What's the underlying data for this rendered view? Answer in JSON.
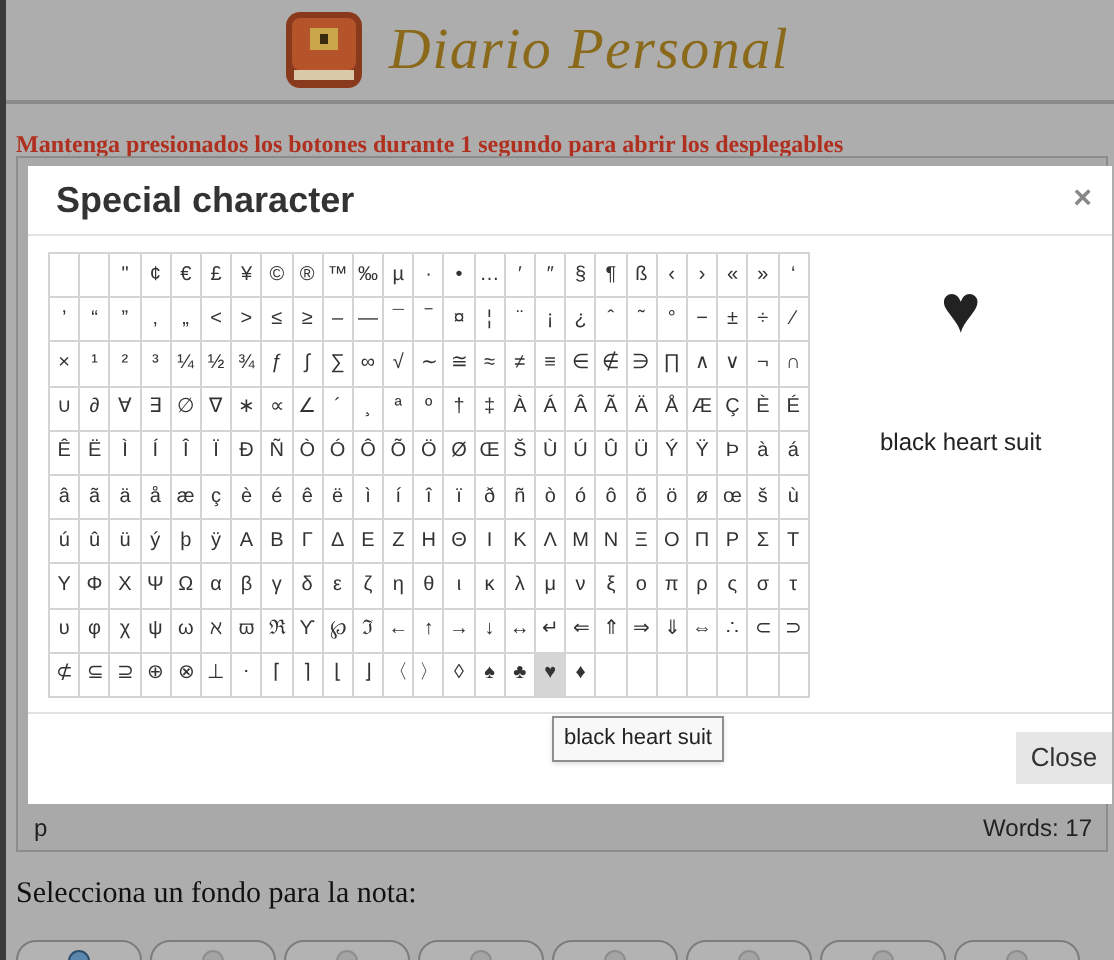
{
  "header": {
    "title": "Diario Personal"
  },
  "notice": "Mantenga presionados los botones durante 1 segundo para abrir los desplegables",
  "dialog": {
    "title": "Special character",
    "close_symbol": "×",
    "grid": [
      [
        {
          "selected": false
        },
        {
          "selected": false
        },
        {
          "c": "\"",
          "selected": false
        },
        {
          "c": "¢",
          "selected": false
        },
        {
          "c": "€",
          "selected": false
        },
        {
          "c": "£",
          "selected": false
        },
        {
          "c": "¥",
          "selected": false
        },
        {
          "c": "©",
          "selected": false
        },
        {
          "c": "®",
          "selected": false
        },
        {
          "c": "™",
          "selected": false
        },
        {
          "c": "‰",
          "selected": false
        },
        {
          "c": "µ",
          "selected": false
        },
        {
          "c": "·",
          "selected": false
        },
        {
          "c": "•",
          "selected": false
        },
        {
          "c": "…",
          "selected": false
        },
        {
          "c": "′",
          "selected": false
        },
        {
          "c": "″",
          "selected": false
        },
        {
          "c": "§",
          "selected": false
        },
        {
          "c": "¶",
          "selected": false
        },
        {
          "c": "ß",
          "selected": false
        },
        {
          "c": "‹",
          "selected": false
        },
        {
          "c": "›",
          "selected": false
        },
        {
          "c": "«",
          "selected": false
        },
        {
          "c": "»",
          "selected": false
        },
        {
          "c": "‘",
          "selected": false
        }
      ],
      [
        {
          "c": "’",
          "selected": false
        },
        {
          "c": "“",
          "selected": false
        },
        {
          "c": "”",
          "selected": false
        },
        {
          "c": "‚",
          "selected": false
        },
        {
          "c": "„",
          "selected": false
        },
        {
          "c": "<",
          "selected": false
        },
        {
          "c": ">",
          "selected": false
        },
        {
          "c": "≤",
          "selected": false
        },
        {
          "c": "≥",
          "selected": false
        },
        {
          "c": "–",
          "selected": false
        },
        {
          "c": "—",
          "selected": false
        },
        {
          "c": "¯",
          "selected": false
        },
        {
          "c": "‾",
          "selected": false
        },
        {
          "c": "¤",
          "selected": false
        },
        {
          "c": "¦",
          "selected": false
        },
        {
          "c": "¨",
          "selected": false
        },
        {
          "c": "¡",
          "selected": false
        },
        {
          "c": "¿",
          "selected": false
        },
        {
          "c": "ˆ",
          "selected": false
        },
        {
          "c": "˜",
          "selected": false
        },
        {
          "c": "°",
          "selected": false
        },
        {
          "c": "−",
          "selected": false
        },
        {
          "c": "±",
          "selected": false
        },
        {
          "c": "÷",
          "selected": false
        },
        {
          "c": "⁄",
          "selected": false
        }
      ],
      [
        {
          "c": "×",
          "selected": false
        },
        {
          "c": "¹",
          "selected": false
        },
        {
          "c": "²",
          "selected": false
        },
        {
          "c": "³",
          "selected": false
        },
        {
          "c": "¼",
          "selected": false
        },
        {
          "c": "½",
          "selected": false
        },
        {
          "c": "¾",
          "selected": false
        },
        {
          "c": "ƒ",
          "selected": false
        },
        {
          "c": "∫",
          "selected": false
        },
        {
          "c": "∑",
          "selected": false
        },
        {
          "c": "∞",
          "selected": false
        },
        {
          "c": "√",
          "selected": false
        },
        {
          "c": "∼",
          "selected": false
        },
        {
          "c": "≅",
          "selected": false
        },
        {
          "c": "≈",
          "selected": false
        },
        {
          "c": "≠",
          "selected": false
        },
        {
          "c": "≡",
          "selected": false
        },
        {
          "c": "∈",
          "selected": false
        },
        {
          "c": "∉",
          "selected": false
        },
        {
          "c": "∋",
          "selected": false
        },
        {
          "c": "∏",
          "selected": false
        },
        {
          "c": "∧",
          "selected": false
        },
        {
          "c": "∨",
          "selected": false
        },
        {
          "c": "¬",
          "selected": false
        },
        {
          "c": "∩",
          "selected": false
        }
      ],
      [
        {
          "c": "∪",
          "selected": false
        },
        {
          "c": "∂",
          "selected": false
        },
        {
          "c": "∀",
          "selected": false
        },
        {
          "c": "∃",
          "selected": false
        },
        {
          "c": "∅",
          "selected": false
        },
        {
          "c": "∇",
          "selected": false
        },
        {
          "c": "∗",
          "selected": false
        },
        {
          "c": "∝",
          "selected": false
        },
        {
          "c": "∠",
          "selected": false
        },
        {
          "c": "´",
          "selected": false
        },
        {
          "c": "¸",
          "selected": false
        },
        {
          "c": "ª",
          "selected": false
        },
        {
          "c": "º",
          "selected": false
        },
        {
          "c": "†",
          "selected": false
        },
        {
          "c": "‡",
          "selected": false
        },
        {
          "c": "À",
          "selected": false
        },
        {
          "c": "Á",
          "selected": false
        },
        {
          "c": "Â",
          "selected": false
        },
        {
          "c": "Ã",
          "selected": false
        },
        {
          "c": "Ä",
          "selected": false
        },
        {
          "c": "Å",
          "selected": false
        },
        {
          "c": "Æ",
          "selected": false
        },
        {
          "c": "Ç",
          "selected": false
        },
        {
          "c": "È",
          "selected": false
        },
        {
          "c": "É",
          "selected": false
        }
      ],
      [
        {
          "c": "Ê",
          "selected": false
        },
        {
          "c": "Ë",
          "selected": false
        },
        {
          "c": "Ì",
          "selected": false
        },
        {
          "c": "Í",
          "selected": false
        },
        {
          "c": "Î",
          "selected": false
        },
        {
          "c": "Ï",
          "selected": false
        },
        {
          "c": "Ð",
          "selected": false
        },
        {
          "c": "Ñ",
          "selected": false
        },
        {
          "c": "Ò",
          "selected": false
        },
        {
          "c": "Ó",
          "selected": false
        },
        {
          "c": "Ô",
          "selected": false
        },
        {
          "c": "Õ",
          "selected": false
        },
        {
          "c": "Ö",
          "selected": false
        },
        {
          "c": "Ø",
          "selected": false
        },
        {
          "c": "Œ",
          "selected": false
        },
        {
          "c": "Š",
          "selected": false
        },
        {
          "c": "Ù",
          "selected": false
        },
        {
          "c": "Ú",
          "selected": false
        },
        {
          "c": "Û",
          "selected": false
        },
        {
          "c": "Ü",
          "selected": false
        },
        {
          "c": "Ý",
          "selected": false
        },
        {
          "c": "Ÿ",
          "selected": false
        },
        {
          "c": "Þ",
          "selected": false
        },
        {
          "c": "à",
          "selected": false
        },
        {
          "c": "á",
          "selected": false
        }
      ],
      [
        {
          "c": "â",
          "selected": false
        },
        {
          "c": "ã",
          "selected": false
        },
        {
          "c": "ä",
          "selected": false
        },
        {
          "c": "å",
          "selected": false
        },
        {
          "c": "æ",
          "selected": false
        },
        {
          "c": "ç",
          "selected": false
        },
        {
          "c": "è",
          "selected": false
        },
        {
          "c": "é",
          "selected": false
        },
        {
          "c": "ê",
          "selected": false
        },
        {
          "c": "ë",
          "selected": false
        },
        {
          "c": "ì",
          "selected": false
        },
        {
          "c": "í",
          "selected": false
        },
        {
          "c": "î",
          "selected": false
        },
        {
          "c": "ï",
          "selected": false
        },
        {
          "c": "ð",
          "selected": false
        },
        {
          "c": "ñ",
          "selected": false
        },
        {
          "c": "ò",
          "selected": false
        },
        {
          "c": "ó",
          "selected": false
        },
        {
          "c": "ô",
          "selected": false
        },
        {
          "c": "õ",
          "selected": false
        },
        {
          "c": "ö",
          "selected": false
        },
        {
          "c": "ø",
          "selected": false
        },
        {
          "c": "œ",
          "selected": false
        },
        {
          "c": "š",
          "selected": false
        },
        {
          "c": "ù",
          "selected": false
        }
      ],
      [
        {
          "c": "ú",
          "selected": false
        },
        {
          "c": "û",
          "selected": false
        },
        {
          "c": "ü",
          "selected": false
        },
        {
          "c": "ý",
          "selected": false
        },
        {
          "c": "þ",
          "selected": false
        },
        {
          "c": "ÿ",
          "selected": false
        },
        {
          "c": "Α",
          "selected": false
        },
        {
          "c": "Β",
          "selected": false
        },
        {
          "c": "Γ",
          "selected": false
        },
        {
          "c": "Δ",
          "selected": false
        },
        {
          "c": "Ε",
          "selected": false
        },
        {
          "c": "Ζ",
          "selected": false
        },
        {
          "c": "Η",
          "selected": false
        },
        {
          "c": "Θ",
          "selected": false
        },
        {
          "c": "Ι",
          "selected": false
        },
        {
          "c": "Κ",
          "selected": false
        },
        {
          "c": "Λ",
          "selected": false
        },
        {
          "c": "Μ",
          "selected": false
        },
        {
          "c": "Ν",
          "selected": false
        },
        {
          "c": "Ξ",
          "selected": false
        },
        {
          "c": "Ο",
          "selected": false
        },
        {
          "c": "Π",
          "selected": false
        },
        {
          "c": "Ρ",
          "selected": false
        },
        {
          "c": "Σ",
          "selected": false
        },
        {
          "c": "Τ",
          "selected": false
        }
      ],
      [
        {
          "c": "Υ",
          "selected": false
        },
        {
          "c": "Φ",
          "selected": false
        },
        {
          "c": "Χ",
          "selected": false
        },
        {
          "c": "Ψ",
          "selected": false
        },
        {
          "c": "Ω",
          "selected": false
        },
        {
          "c": "α",
          "selected": false
        },
        {
          "c": "β",
          "selected": false
        },
        {
          "c": "γ",
          "selected": false
        },
        {
          "c": "δ",
          "selected": false
        },
        {
          "c": "ε",
          "selected": false
        },
        {
          "c": "ζ",
          "selected": false
        },
        {
          "c": "η",
          "selected": false
        },
        {
          "c": "θ",
          "selected": false
        },
        {
          "c": "ι",
          "selected": false
        },
        {
          "c": "κ",
          "selected": false
        },
        {
          "c": "λ",
          "selected": false
        },
        {
          "c": "μ",
          "selected": false
        },
        {
          "c": "ν",
          "selected": false
        },
        {
          "c": "ξ",
          "selected": false
        },
        {
          "c": "ο",
          "selected": false
        },
        {
          "c": "π",
          "selected": false
        },
        {
          "c": "ρ",
          "selected": false
        },
        {
          "c": "ς",
          "selected": false
        },
        {
          "c": "σ",
          "selected": false
        },
        {
          "c": "τ",
          "selected": false
        }
      ],
      [
        {
          "c": "υ",
          "selected": false
        },
        {
          "c": "φ",
          "selected": false
        },
        {
          "c": "χ",
          "selected": false
        },
        {
          "c": "ψ",
          "selected": false
        },
        {
          "c": "ω",
          "selected": false
        },
        {
          "c": "ℵ",
          "selected": false
        },
        {
          "c": "ϖ",
          "selected": false
        },
        {
          "c": "ℜ",
          "selected": false
        },
        {
          "c": "ϒ",
          "selected": false
        },
        {
          "c": "℘",
          "selected": false
        },
        {
          "c": "ℑ",
          "selected": false
        },
        {
          "c": "←",
          "selected": false
        },
        {
          "c": "↑",
          "selected": false
        },
        {
          "c": "→",
          "selected": false
        },
        {
          "c": "↓",
          "selected": false
        },
        {
          "c": "↔",
          "selected": false
        },
        {
          "c": "↵",
          "selected": false
        },
        {
          "c": "⇐",
          "selected": false
        },
        {
          "c": "⇑",
          "selected": false
        },
        {
          "c": "⇒",
          "selected": false
        },
        {
          "c": "⇓",
          "selected": false
        },
        {
          "c": "⇔",
          "selected": false
        },
        {
          "c": "∴",
          "selected": false
        },
        {
          "c": "⊂",
          "selected": false
        },
        {
          "c": "⊃",
          "selected": false
        }
      ],
      [
        {
          "c": "⊄",
          "selected": false
        },
        {
          "c": "⊆",
          "selected": false
        },
        {
          "c": "⊇",
          "selected": false
        },
        {
          "c": "⊕",
          "selected": false
        },
        {
          "c": "⊗",
          "selected": false
        },
        {
          "c": "⊥",
          "selected": false
        },
        {
          "c": "⋅",
          "selected": false
        },
        {
          "c": "⌈",
          "selected": false
        },
        {
          "c": "⌉",
          "selected": false
        },
        {
          "c": "⌊",
          "selected": false
        },
        {
          "c": "⌋",
          "selected": false
        },
        {
          "c": "〈",
          "selected": false
        },
        {
          "c": "〉",
          "selected": false
        },
        {
          "c": "◊",
          "selected": false
        },
        {
          "c": "♠",
          "selected": false
        },
        {
          "c": "♣",
          "selected": false
        },
        {
          "c": "♥",
          "selected": true
        },
        {
          "c": "♦",
          "selected": false
        },
        {
          "selected": false
        },
        {
          "selected": false
        },
        {
          "selected": false
        },
        {
          "selected": false
        },
        {
          "selected": false
        },
        {
          "selected": false
        },
        {
          "selected": false
        }
      ]
    ],
    "preview": {
      "char": "♥",
      "name": "black heart suit"
    },
    "tooltip": "black heart suit",
    "buttons": [
      "Close"
    ]
  },
  "editor_status": {
    "path": "p",
    "words": "Words: 17"
  },
  "background_prompt": "Selecciona un fondo para la nota:",
  "backgrounds": [
    {
      "selected": true
    },
    {
      "selected": false
    },
    {
      "selected": false
    },
    {
      "selected": false
    },
    {
      "selected": false
    },
    {
      "selected": false
    },
    {
      "selected": false
    },
    {
      "selected": false
    }
  ]
}
